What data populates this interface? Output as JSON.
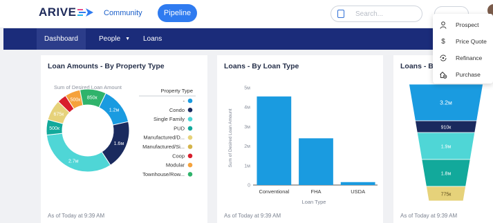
{
  "header": {
    "logo_text": "ARIVE",
    "nav": {
      "community": "Community",
      "pipeline": "Pipeline"
    },
    "search_placeholder": "Search..."
  },
  "subnav": {
    "dashboard": "Dashboard",
    "people": "People",
    "loans": "Loans"
  },
  "menu": {
    "items": [
      {
        "label": "Prospect",
        "icon": "person-icon"
      },
      {
        "label": "Price Quote",
        "icon": "dollar-icon"
      },
      {
        "label": "Refinance",
        "icon": "refinance-icon"
      },
      {
        "label": "Purchase",
        "icon": "house-add-icon"
      }
    ]
  },
  "cards": {
    "property": {
      "title": "Loan Amounts - By Property Type",
      "footnote": "As of Today at 9:39 AM"
    },
    "loantype": {
      "title": "Loans - By Loan Type",
      "footnote": "As of Today at 9:39 AM"
    },
    "funnel": {
      "title": "Loans - By",
      "footnote": "As of Today at 9:39 AM"
    }
  },
  "chart_data": [
    {
      "type": "pie",
      "title": "Sum of Desired Loan Amount",
      "legend_title": "Property Type",
      "legend_placement": "right",
      "categories": [
        "-",
        "Condo",
        "Single Family",
        "PUD",
        "Manufactured/D...",
        "Manufactured/Si...",
        "Coop",
        "Modular",
        "Townhouse/Row..."
      ],
      "colors": [
        "#1a9be0",
        "#1a2a5e",
        "#4fd6d6",
        "#12a99b",
        "#e6d27a",
        "#d4b44a",
        "#d81e2c",
        "#f5a23c",
        "#2fb36b"
      ],
      "values": [
        1.2,
        1.6,
        2.7,
        0.5,
        0.675,
        0,
        0.3,
        0.5,
        0.85
      ],
      "labels": [
        "1.2м",
        "1.6м",
        "2.7м",
        "500к",
        "675к",
        "",
        "",
        "500к",
        "850к"
      ]
    },
    {
      "type": "bar",
      "categories": [
        "Conventional",
        "FHA",
        "USDA"
      ],
      "values": [
        4.55,
        2.4,
        0.15
      ],
      "xlabel": "Loan Type",
      "ylabel": "Sum of Desired Loan Amount",
      "ylim": [
        0,
        5
      ],
      "yticks": [
        "0",
        "1м",
        "2м",
        "3м",
        "4м",
        "5м"
      ],
      "color": "#1a9be0",
      "grid": false
    },
    {
      "type": "funnel",
      "values": [
        3.2,
        0.91,
        1.9,
        1.8,
        0.775
      ],
      "labels": [
        "3.2м",
        "910к",
        "1.9м",
        "1.8м",
        "775к"
      ],
      "colors": [
        "#1a9be0",
        "#1a2a5e",
        "#4fd6d6",
        "#12a99b",
        "#e6d27a"
      ]
    }
  ]
}
